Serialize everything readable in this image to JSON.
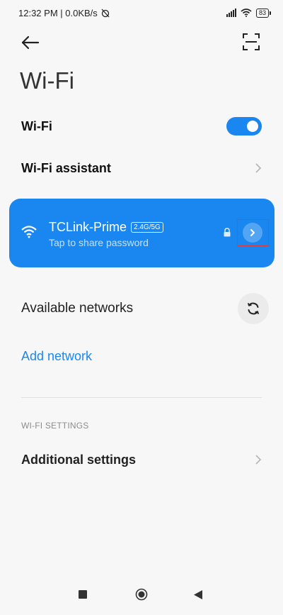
{
  "status_bar": {
    "time_speed": "12:32 PM | 0.0KB/s",
    "battery": "83"
  },
  "top_bar": {
    "back_icon": "back-arrow-icon",
    "scan_icon": "scan-qr-icon"
  },
  "page": {
    "title": "Wi-Fi"
  },
  "wifi_toggle": {
    "label": "Wi-Fi",
    "state": "on"
  },
  "wifi_assistant": {
    "label": "Wi-Fi assistant"
  },
  "connected_network": {
    "name": "TCLink-Prime",
    "band": "2.4G/5G",
    "subtitle": "Tap to share password",
    "color": "#1a87f0"
  },
  "available_networks": {
    "label": "Available networks"
  },
  "add_network": {
    "label": "Add network"
  },
  "wifi_settings_section": {
    "header": "WI-FI SETTINGS"
  },
  "additional_settings": {
    "label": "Additional settings"
  },
  "colors": {
    "accent": "#1a87f0",
    "highlight": "#e53935"
  }
}
